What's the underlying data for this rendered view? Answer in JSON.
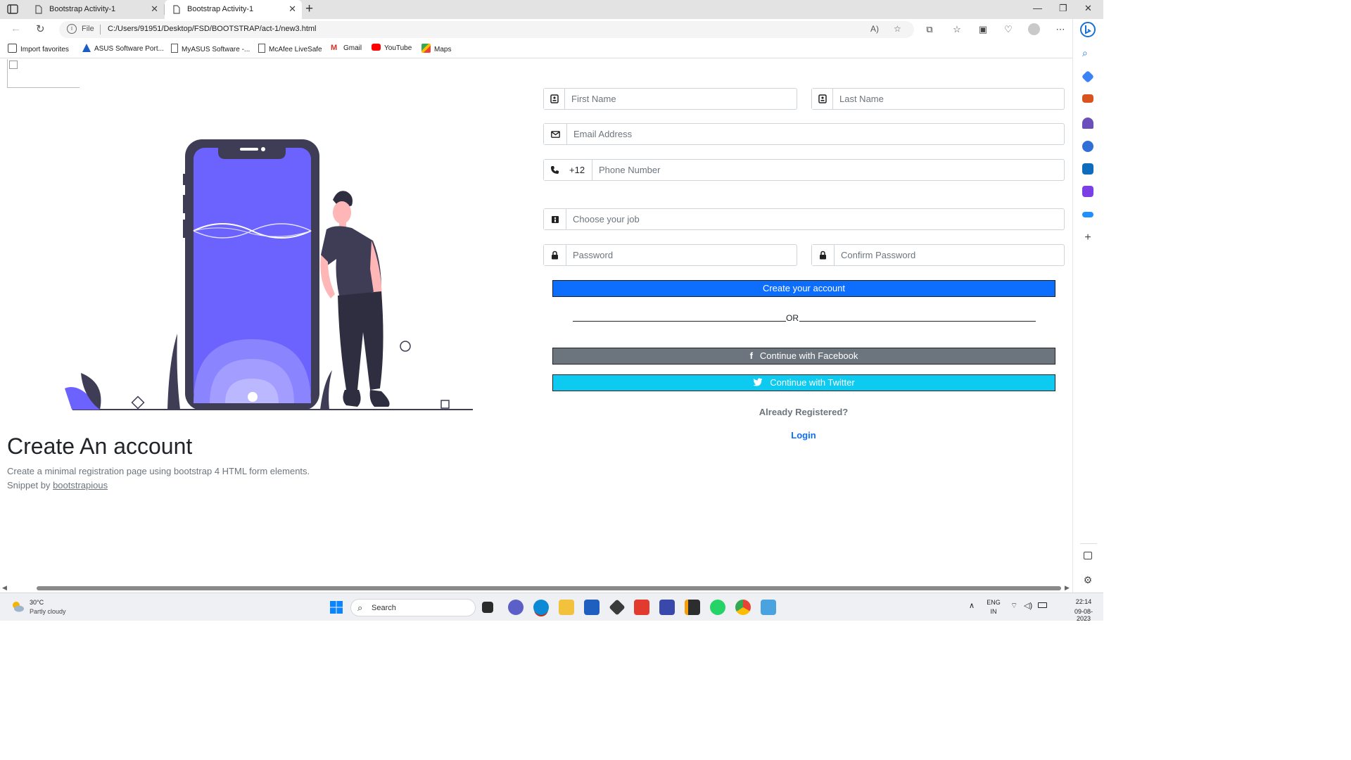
{
  "browser": {
    "tabs": [
      {
        "title": "Bootstrap Activity-1",
        "active": false
      },
      {
        "title": "Bootstrap Activity-1",
        "active": true
      }
    ],
    "address": {
      "scheme_label": "File",
      "url": "C:/Users/91951/Desktop/FSD/BOOTSTRAP/act-1/new3.html"
    },
    "favorites": [
      {
        "label": "Import favorites",
        "icon": "import-icon"
      },
      {
        "label": "ASUS Software Port...",
        "icon": "asus-icon"
      },
      {
        "label": "MyASUS Software -...",
        "icon": "page-icon"
      },
      {
        "label": "McAfee LiveSafe",
        "icon": "page-icon"
      },
      {
        "label": "Gmail",
        "icon": "gmail-icon"
      },
      {
        "label": "YouTube",
        "icon": "youtube-icon"
      },
      {
        "label": "Maps",
        "icon": "maps-icon"
      }
    ]
  },
  "page": {
    "title": "Create An account",
    "description": "Create a minimal registration page using bootstrap 4 HTML form elements.",
    "snippet_prefix": "Snippet by",
    "snippet_link": "bootstrapious"
  },
  "form": {
    "first_name": {
      "placeholder": "First Name",
      "value": ""
    },
    "last_name": {
      "placeholder": "Last Name",
      "value": ""
    },
    "email": {
      "placeholder": "Email Address",
      "value": ""
    },
    "phone_prefix": "+12",
    "phone": {
      "placeholder": "Phone Number",
      "value": ""
    },
    "job": {
      "placeholder": "Choose your job",
      "value": ""
    },
    "password": {
      "placeholder": "Password",
      "value": ""
    },
    "confirm_password": {
      "placeholder": "Confirm Password",
      "value": ""
    },
    "submit_label": "Create your account",
    "or_text": "OR",
    "facebook_label": "Continue with Facebook",
    "twitter_label": "Continue with Twitter",
    "already_text": "Already Registered?",
    "login_label": "Login"
  },
  "taskbar": {
    "weather_temp": "30°C",
    "weather_condition": "Partly cloudy",
    "search_label": "Search",
    "lang": "ENG",
    "region": "IN",
    "time": "22:14",
    "date": "09-08-2023"
  },
  "colors": {
    "primary": "#0d6efd",
    "secondary": "#6c757d",
    "info": "#0dcaf0",
    "illustration_accent": "#6c63ff",
    "illustration_dark": "#3f3d56"
  }
}
